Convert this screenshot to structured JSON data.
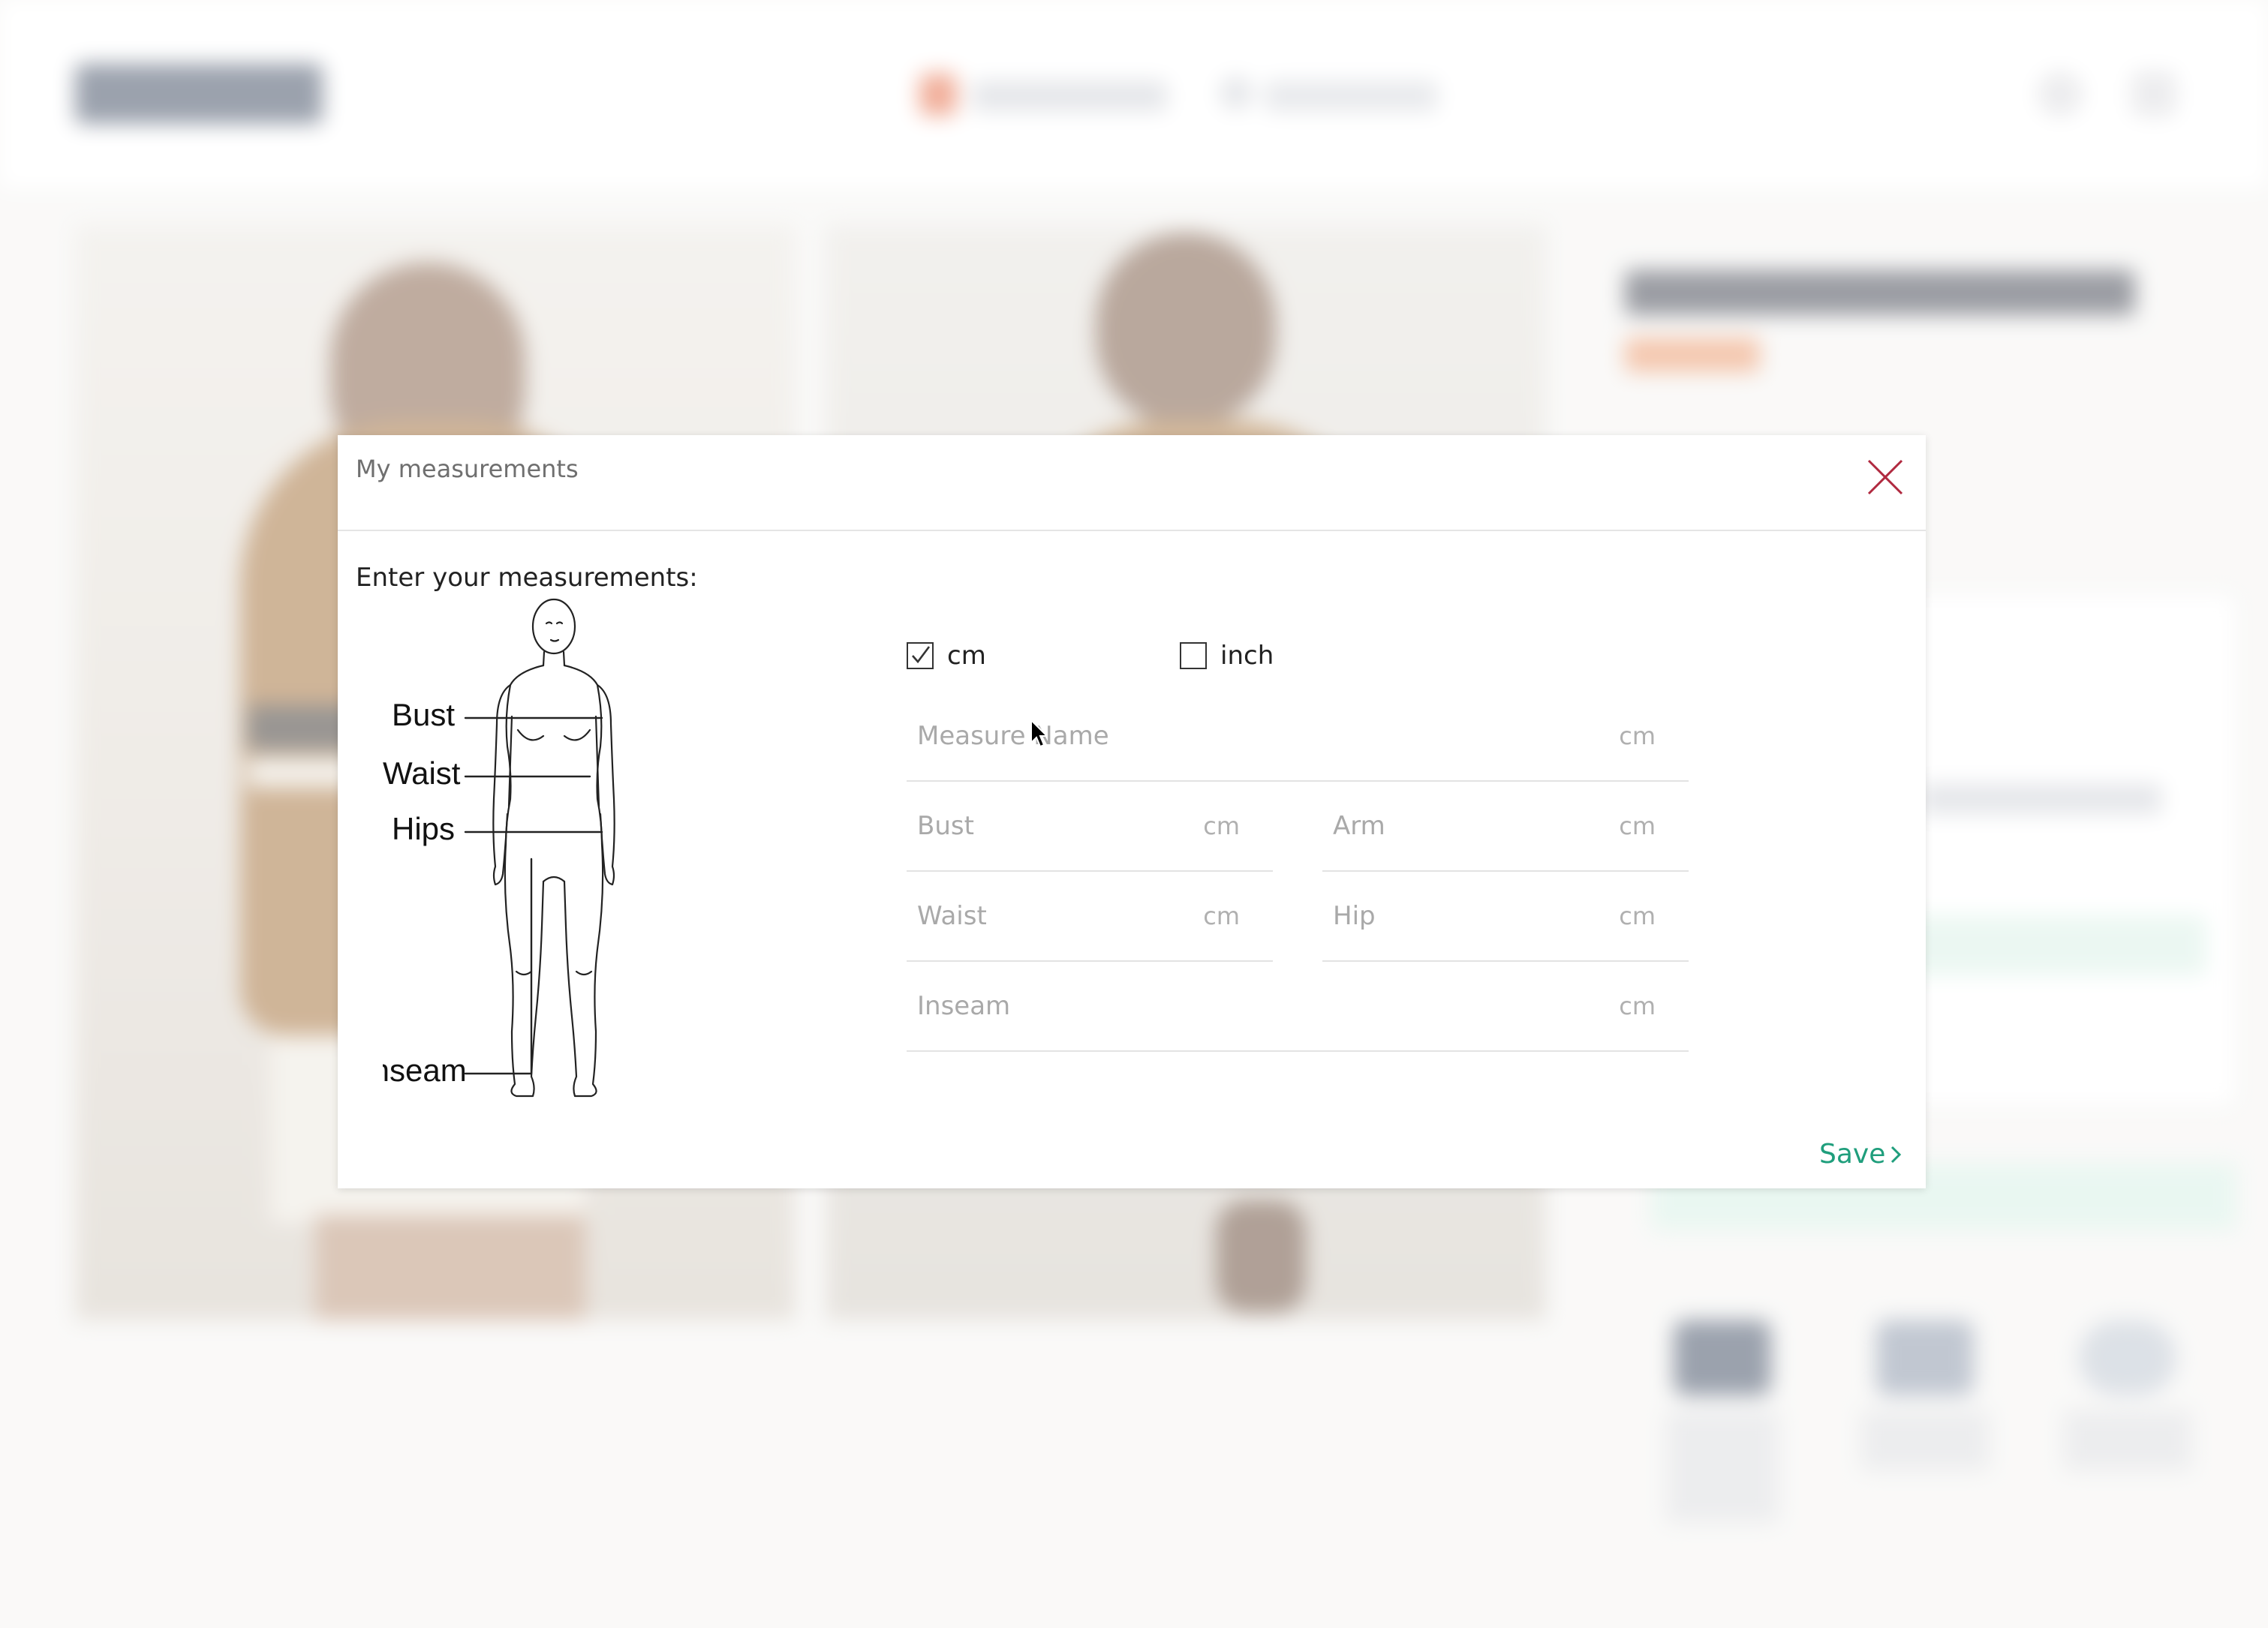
{
  "background": {
    "accent_color": "#e2572c",
    "brand_color": "#2f3d55"
  },
  "modal": {
    "title": "My measurements",
    "close_icon": "close-icon",
    "instruction": "Enter your measurements:",
    "figure_labels": {
      "bust": "Bust",
      "waist": "Waist",
      "hips": "Hips",
      "inseam": "Inseam"
    },
    "units": {
      "cm": {
        "label": "cm",
        "checked": true
      },
      "inch": {
        "label": "inch",
        "checked": false
      }
    },
    "fields": {
      "measure_name": {
        "placeholder": "Measure Name",
        "unit": "cm",
        "value": ""
      },
      "bust": {
        "placeholder": "Bust",
        "unit": "cm",
        "value": ""
      },
      "arm": {
        "placeholder": "Arm",
        "unit": "cm",
        "value": ""
      },
      "waist": {
        "placeholder": "Waist",
        "unit": "cm",
        "value": ""
      },
      "hip": {
        "placeholder": "Hip",
        "unit": "cm",
        "value": ""
      },
      "inseam": {
        "placeholder": "Inseam",
        "unit": "cm",
        "value": ""
      }
    },
    "save_label": "Save",
    "save_color": "#1f9e7c",
    "close_color": "#b0293f"
  }
}
